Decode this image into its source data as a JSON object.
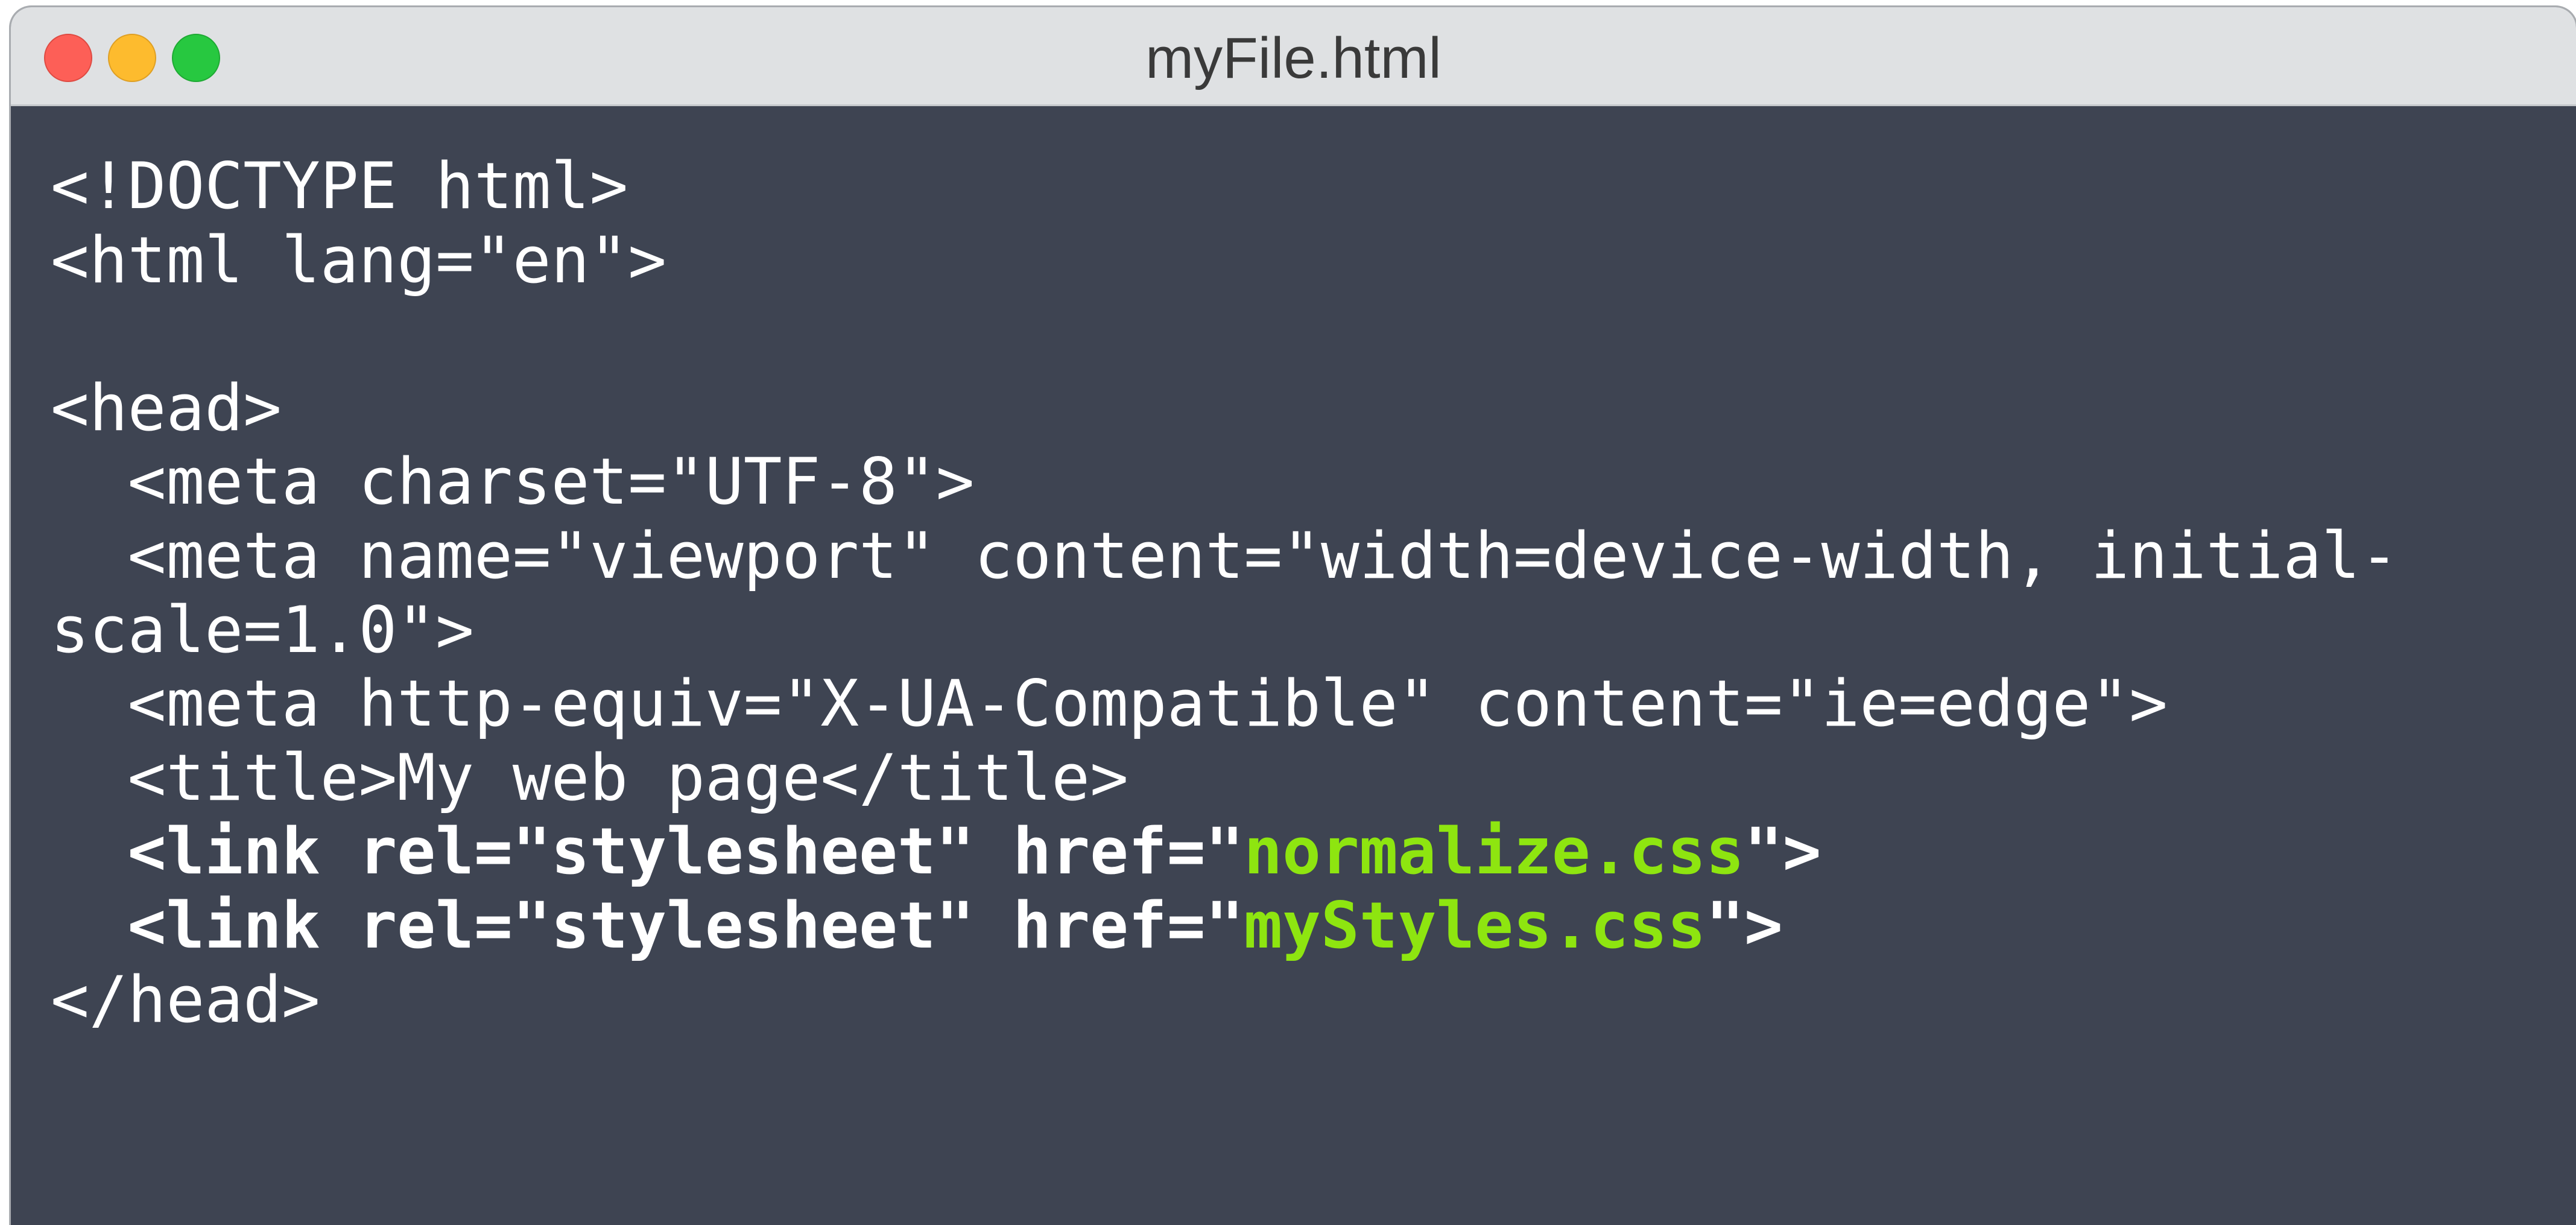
{
  "window": {
    "title": "myFile.html"
  },
  "colors": {
    "editor_background": "#3e4452",
    "text": "#ffffff",
    "highlight": "#8ee510",
    "titlebar": "#dfe1e3"
  },
  "code": {
    "line1": "<!DOCTYPE html>",
    "line2": "<html lang=\"en\">",
    "line3": "",
    "line4": "<head>",
    "line5": "  <meta charset=\"UTF-8\">",
    "line6": "  <meta name=\"viewport\" content=\"width=device-width, initial-",
    "line7": "scale=1.0\">",
    "line8": "  <meta http-equiv=\"X-UA-Compatible\" content=\"ie=edge\">",
    "line9": "  <title>My web page</title>",
    "line10_pre": "  <link rel=\"stylesheet\" href=\"",
    "line10_file": "normalize.css",
    "line10_post": "\">",
    "line11_pre": "  <link rel=\"stylesheet\" href=\"",
    "line11_file": "myStyles.css",
    "line11_post": "\">",
    "line12": "</head>"
  }
}
